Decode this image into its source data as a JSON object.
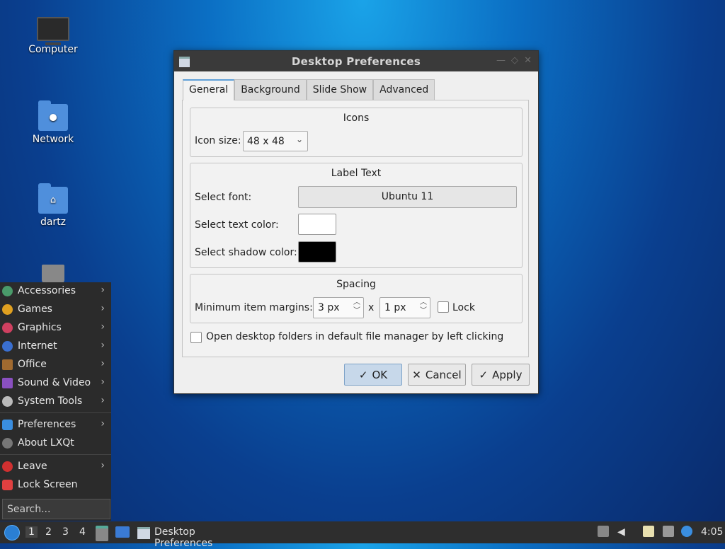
{
  "desktop_icons": [
    {
      "label": "Computer"
    },
    {
      "label": "Network"
    },
    {
      "label": "dartz"
    }
  ],
  "dialog": {
    "title": "Desktop Preferences",
    "tabs": [
      {
        "label": "General"
      },
      {
        "label": "Background"
      },
      {
        "label": "Slide Show"
      },
      {
        "label": "Advanced"
      }
    ],
    "icons_group": {
      "title": "Icons",
      "icon_size_label": "Icon size:",
      "icon_size_value": "48 x 48"
    },
    "label_group": {
      "title": "Label Text",
      "font_label": "Select font:",
      "font_value": "Ubuntu 11",
      "text_color_label": "Select text color:",
      "text_color": "#ffffff",
      "shadow_color_label": "Select shadow color:",
      "shadow_color": "#000000"
    },
    "spacing_group": {
      "title": "Spacing",
      "margins_label": "Minimum item margins:",
      "margin_x": "3 px",
      "separator": "x",
      "margin_y": "1 px",
      "lock_label": "Lock"
    },
    "open_folders_label": "Open desktop folders in default file manager by left clicking",
    "buttons": {
      "ok": "OK",
      "cancel": "Cancel",
      "apply": "Apply"
    }
  },
  "menu": {
    "items": [
      {
        "label": "Accessories",
        "color": "#4a9b6a"
      },
      {
        "label": "Games",
        "color": "#e0a020"
      },
      {
        "label": "Graphics",
        "color": "#d04060"
      },
      {
        "label": "Internet",
        "color": "#3a6fd0"
      },
      {
        "label": "Office",
        "color": "#a06a30"
      },
      {
        "label": "Sound & Video",
        "color": "#8a50c0"
      },
      {
        "label": "System Tools",
        "color": "#bbbbbb"
      },
      {
        "label": "Preferences",
        "color": "#3a8ee0"
      },
      {
        "label": "About LXQt",
        "color": "#777777"
      },
      {
        "label": "Leave",
        "color": "#d03030"
      },
      {
        "label": "Lock Screen",
        "color": "#e04040"
      }
    ],
    "search_placeholder": "Search..."
  },
  "taskbar": {
    "workspaces": [
      "1",
      "2",
      "3",
      "4"
    ],
    "window_title": "Desktop Preferences",
    "clock": "4:05"
  },
  "icons": {
    "checkmark": "✓",
    "cross": "✕",
    "chevron_right": "›",
    "chevron_down": "⌄"
  }
}
